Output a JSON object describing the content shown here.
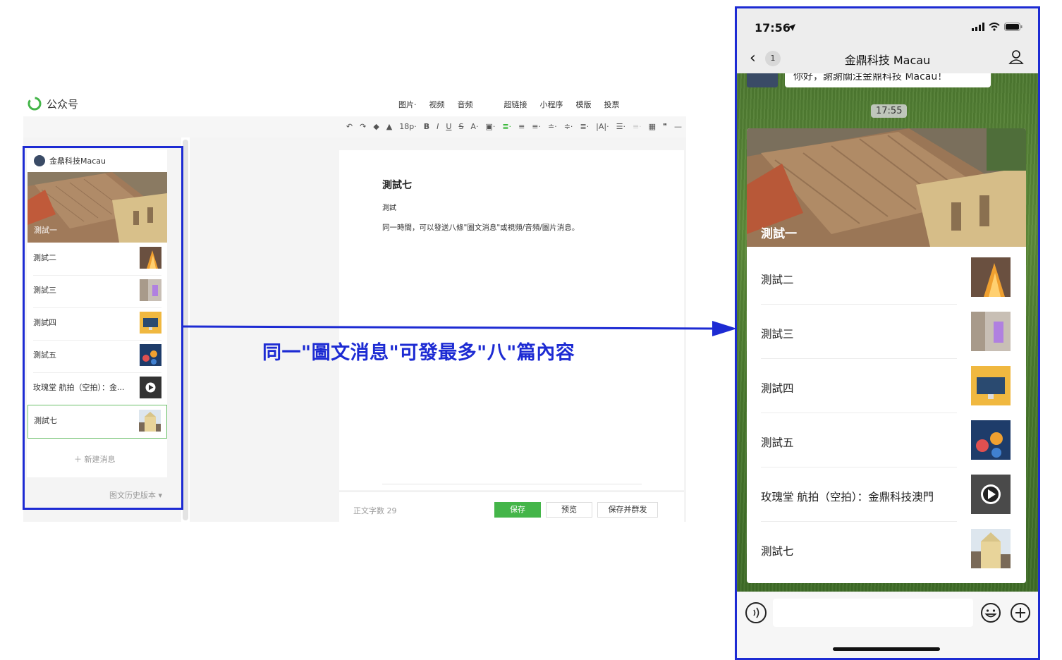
{
  "editor": {
    "logo_label": "公众号",
    "insert_bar": [
      "图片·",
      "视频",
      "音频",
      "超链接",
      "小程序",
      "模版",
      "投票"
    ],
    "format_bar": [
      "↶",
      "↷",
      "◆",
      "▲",
      "18p·",
      "B",
      "I",
      "U",
      "S",
      "A·",
      "▣·",
      "≣·",
      "≡",
      "≡·",
      "≐·",
      "≑·",
      "≣·",
      "|A|·",
      "☰·",
      "≡·",
      "▦",
      "❞",
      "—"
    ],
    "account_name": "金鼎科技Macau",
    "cover_title": "測試一",
    "items": [
      {
        "title": "測試二",
        "thumb": "fire-thumb"
      },
      {
        "title": "測試三",
        "thumb": "purple-thumb"
      },
      {
        "title": "測試四",
        "thumb": "computer-thumb"
      },
      {
        "title": "測試五",
        "thumb": "vr-thumb"
      },
      {
        "title": "玫瑰堂 航拍（空拍）：金...",
        "thumb": "video-thumb"
      },
      {
        "title": "測試七",
        "thumb": "church-thumb"
      }
    ],
    "new_message": "＋ 新建消息",
    "history": "图文历史版本 ▾",
    "article": {
      "title": "測試七",
      "author": "測試",
      "body": "同一時間，可以發送八條\"圖文消息\"或視頻/音頻/圖片消息。"
    },
    "word_count": "正文字数 29",
    "buttons": {
      "save": "保存",
      "preview": "预览",
      "save_mass": "保存并群发"
    }
  },
  "caption": "同一\"圖文消息\"可發最多\"八\"篇內容",
  "phone": {
    "time": "17:56",
    "back_badge": "1",
    "title": "金鼎科技 Macau",
    "previous_message": "你好，謝謝關注金鼎科技 Macau！",
    "timestamp": "17:55",
    "cover_title": "測試一",
    "items": [
      {
        "title": "測試二",
        "thumb": "fire-thumb"
      },
      {
        "title": "測試三",
        "thumb": "purple-thumb"
      },
      {
        "title": "測試四",
        "thumb": "computer-thumb"
      },
      {
        "title": "測試五",
        "thumb": "vr-thumb"
      },
      {
        "title": "玫瑰堂 航拍（空拍）：金鼎科技澳門",
        "thumb": "video-thumb"
      },
      {
        "title": "測試七",
        "thumb": "church-thumb"
      }
    ]
  },
  "colors": {
    "accent_blue": "#1d2bd3",
    "wechat_green": "#44b549"
  }
}
